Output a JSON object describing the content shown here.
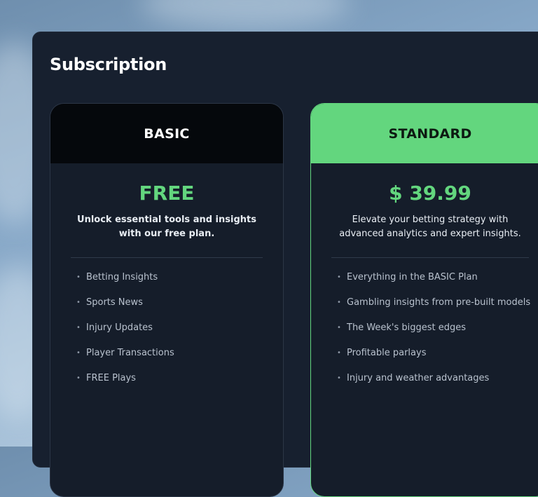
{
  "page": {
    "title": "Subscription"
  },
  "plans": [
    {
      "name": "BASIC",
      "price": "FREE",
      "description": "Unlock essential tools and insights with our free plan.",
      "features": [
        "Betting Insights",
        "Sports News",
        "Injury Updates",
        "Player Transactions",
        "FREE Plays"
      ]
    },
    {
      "name": "STANDARD",
      "price": "$ 39.99",
      "description": "Elevate your betting strategy with advanced analytics and expert insights.",
      "features": [
        "Everything in the BASIC Plan",
        "Gambling insights from pre-built models",
        "The Week's biggest edges",
        "Profitable parlays",
        "Injury and weather advantages"
      ]
    }
  ],
  "colors": {
    "accent": "#63d67e",
    "panel": "#17202f",
    "basic_header": "#05080c"
  },
  "icons": {
    "bullet": "bullet-dot-icon"
  }
}
